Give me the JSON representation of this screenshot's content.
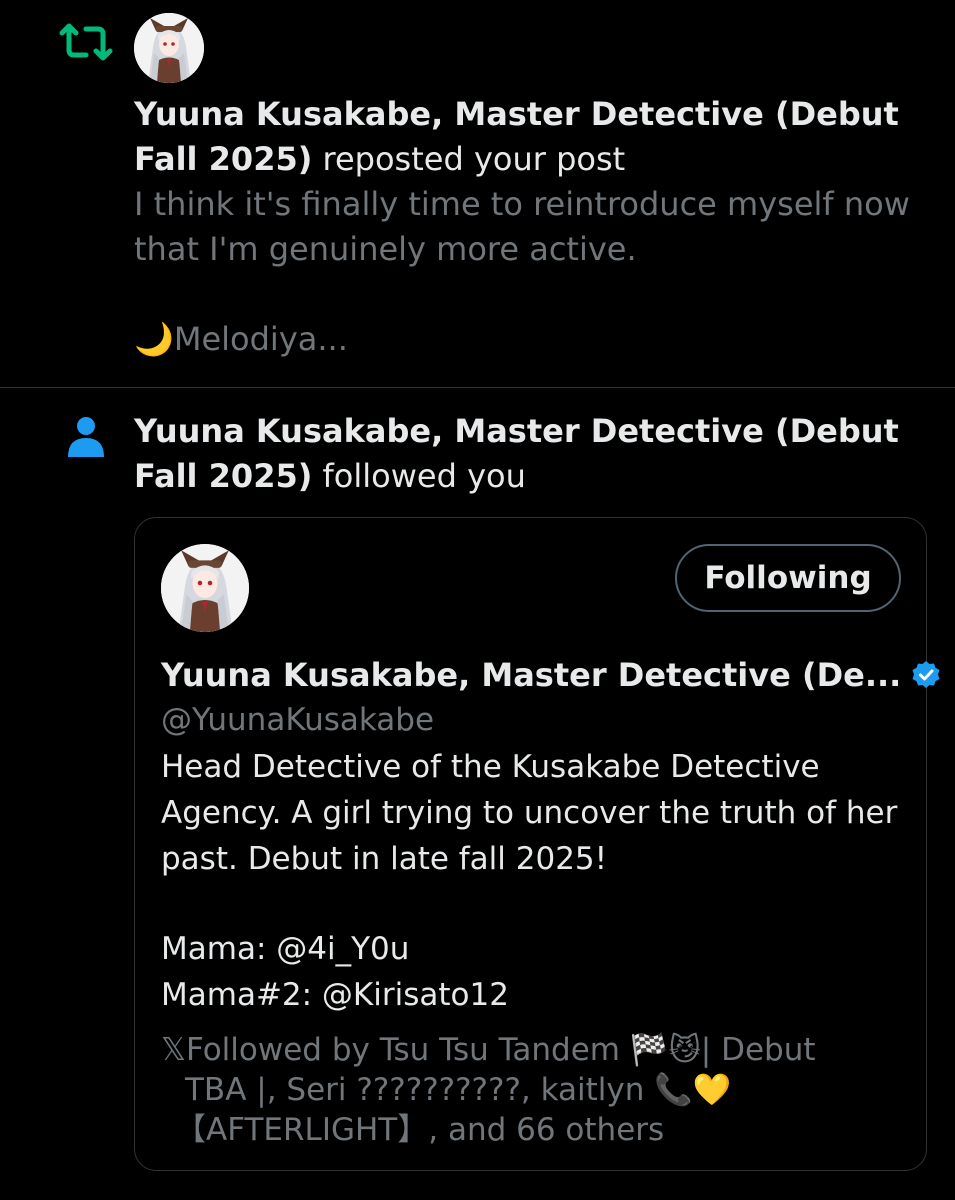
{
  "colors": {
    "background": "#000000",
    "text_primary": "#e7e9ea",
    "text_secondary": "#71767b",
    "repost_green": "#00ba7c",
    "follow_blue": "#1d9bf0",
    "divider": "#2f3336"
  },
  "notifications": [
    {
      "type": "repost",
      "icon": "repost-icon",
      "user_name": "Yuuna Kusakabe, Master Detective (Debut Fall 2025)",
      "action": "reposted your post",
      "post_preview": {
        "line1": "I think it's finally time to reintroduce myself now",
        "line2": "that I'm genuinely more active.",
        "line3": "🌙Melodiya..."
      }
    },
    {
      "type": "follow",
      "icon": "person-icon",
      "user_name": "Yuuna Kusakabe, Master Detective (Debut Fall 2025)",
      "action": "followed you",
      "user_card": {
        "display_name": "Yuuna Kusakabe, Master Detective (De...",
        "verified": true,
        "handle": "@YuunaKusakabe",
        "follow_button_label": "Following",
        "bio": {
          "line1": "Head Detective of the Kusakabe Detective",
          "line2": "Agency. A girl trying to uncover the truth of her",
          "line3": "past. Debut in late fall 2025!",
          "line4": "Mama: @4i_Y0u",
          "line5": "Mama#2: @Kirisato12"
        },
        "followed_by": {
          "line1": "𝕏Followed by Tsu Tsu Tandem 🏁😼| Debut",
          "line2": "TBA |, Seri ??????????, kaitlyn 📞💛",
          "line3": "【AFTERLIGHT】, and 66 others"
        }
      }
    }
  ]
}
